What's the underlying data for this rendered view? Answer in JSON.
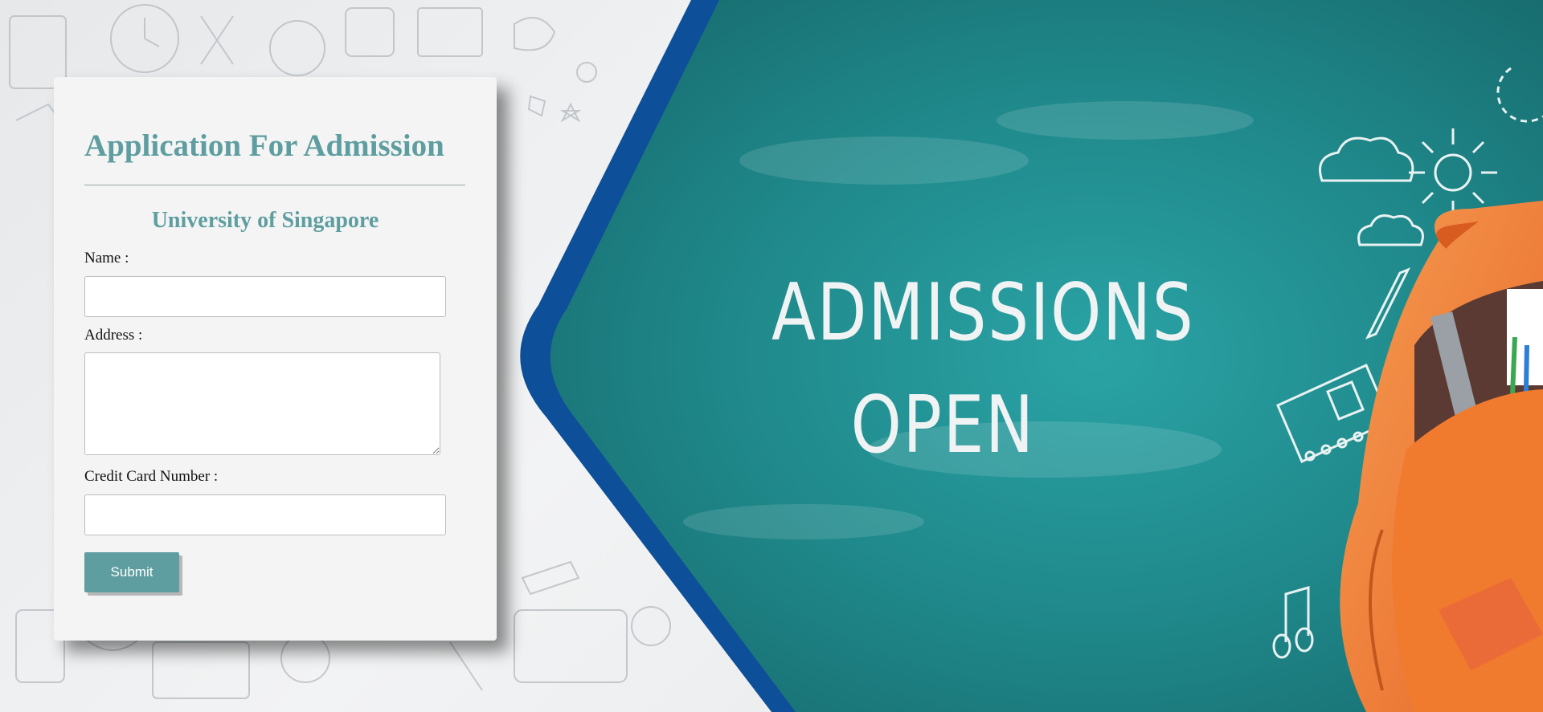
{
  "banner": {
    "line1": "ADMISSIONS",
    "line2": "OPEN"
  },
  "form": {
    "title": "Application For Admission",
    "subtitle": "University of Singapore",
    "name_label": "Name :",
    "name_value": "",
    "address_label": "Address :",
    "address_value": "",
    "cc_label": "Credit Card Number :",
    "cc_value": "",
    "submit_label": "Submit"
  },
  "colors": {
    "accent": "#5f9ea0",
    "board": "#1e7f82",
    "stripe": "#0d4f99",
    "bag": "#f07a2e"
  },
  "icons": [
    "doodle-background",
    "cloud-icon",
    "sun-icon",
    "pencil-icon",
    "notebook-icon",
    "music-note-icon",
    "backpack-icon"
  ]
}
